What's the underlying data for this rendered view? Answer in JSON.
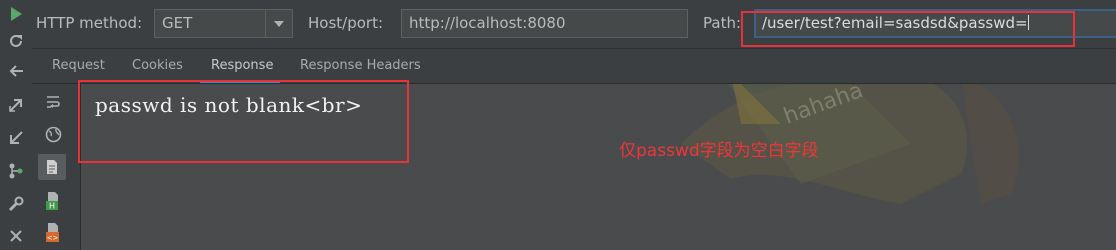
{
  "form": {
    "method_label": "HTTP method:",
    "method_value": "GET",
    "host_label": "Host/port:",
    "host_value": "http://localhost:8080",
    "path_label": "Path:",
    "path_value": "/user/test?email=sasdsd&passwd="
  },
  "tabs": [
    {
      "label": "Request"
    },
    {
      "label": "Cookies"
    },
    {
      "label": "Response",
      "active": true
    },
    {
      "label": "Response Headers"
    }
  ],
  "response": {
    "body": "passwd is not blank<br>"
  },
  "annotation": {
    "note": "仅passwd字段为空白字段",
    "color": "#e8323a"
  },
  "watermark": {
    "text": "hahaha"
  },
  "icons": {
    "left_toolbar": [
      "run-icon",
      "refresh-icon",
      "back-icon",
      "expand-icon",
      "collapse-icon",
      "branch-icon",
      "wrench-icon",
      "close-icon"
    ],
    "response_toolbar": [
      "soft-wrap-icon",
      "globe-icon",
      "document-icon",
      "html-file-icon",
      "xml-file-icon"
    ]
  },
  "colors": {
    "run_green": "#59a869",
    "accent_blue": "#4a88c7",
    "html_badge": "#3f9b4a",
    "xml_badge": "#d4692c"
  }
}
